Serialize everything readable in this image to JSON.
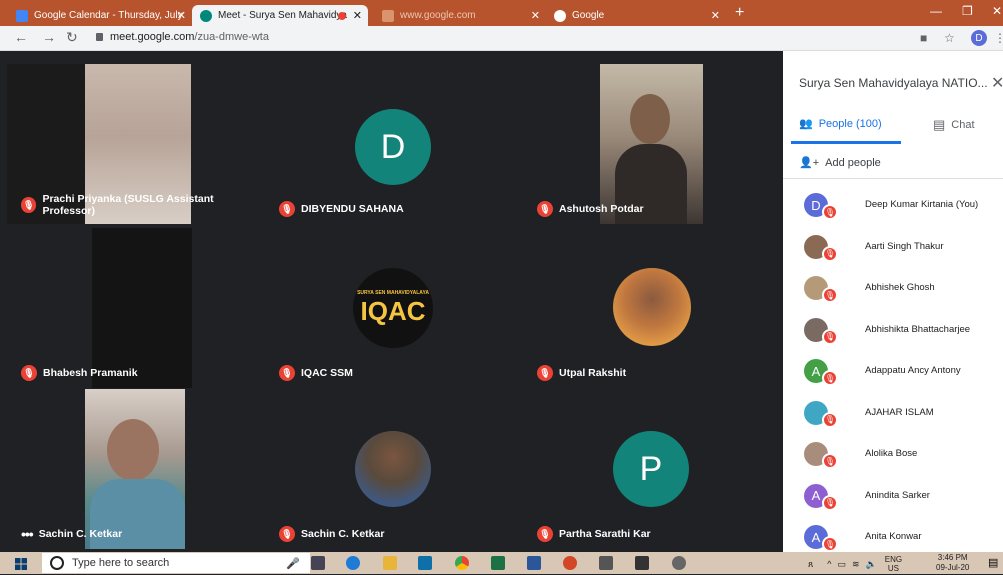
{
  "browser": {
    "tabs": [
      {
        "title": "Google Calendar - Thursday, July",
        "active": false,
        "favicon_color": "#4285f4"
      },
      {
        "title": "Meet - Surya Sen Mahavidya",
        "active": true,
        "favicon_color": "#00897b"
      },
      {
        "title": "www.google.com",
        "active": false,
        "favicon_color": "#d9936d"
      },
      {
        "title": "Google",
        "active": false,
        "favicon_color": "#ffffff"
      }
    ],
    "new_tab": "+",
    "url_host": "meet.google.com",
    "url_path": "/zua-dmwe-wta",
    "profile_initial": "D"
  },
  "participants_grid": [
    {
      "name": "Prachi Priyanka (SUSLG Assistant Professor)",
      "type": "video",
      "muted": true
    },
    {
      "name": "DIBYENDU SAHANA",
      "type": "avatar",
      "initial": "D",
      "color": "#12847a",
      "muted": true
    },
    {
      "name": "Ashutosh Potdar",
      "type": "video",
      "muted": true
    },
    {
      "name": "Bhabesh Pramanik",
      "type": "video",
      "muted": true
    },
    {
      "name": "IQAC SSM",
      "type": "logo",
      "logo_text": "IQAC",
      "logo_subtext": "SURYA SEN MAHAVIDYALAYA",
      "muted": true
    },
    {
      "name": "Utpal Rakshit",
      "type": "photo",
      "muted": true
    },
    {
      "name": "Sachin C. Ketkar",
      "type": "video",
      "muted": false,
      "more": "•••"
    },
    {
      "name": "Sachin C. Ketkar",
      "type": "photo",
      "muted": true
    },
    {
      "name": "Partha Sarathi Kar",
      "type": "avatar",
      "initial": "P",
      "color": "#12847a",
      "muted": true
    }
  ],
  "panel": {
    "title": "Surya Sen Mahavidyalaya NATIO...",
    "people_tab": "People (100)",
    "chat_tab": "Chat",
    "add_people": "Add people",
    "people": [
      {
        "name": "Deep Kumar Kirtania (You)",
        "initial": "D",
        "color": "#5b6bd8"
      },
      {
        "name": "Aarti Singh Thakur",
        "initial": "",
        "color": "#8a6a55"
      },
      {
        "name": "Abhishek Ghosh",
        "initial": "",
        "color": "#b59a7a"
      },
      {
        "name": "Abhishikta Bhattacharjee",
        "initial": "",
        "color": "#7a6b62"
      },
      {
        "name": "Adappatu Ancy Antony",
        "initial": "A",
        "color": "#43a047"
      },
      {
        "name": "AJAHAR ISLAM",
        "initial": "",
        "color": "#3fa7c4"
      },
      {
        "name": "Alolika Bose",
        "initial": "",
        "color": "#a88d7c"
      },
      {
        "name": "Anindita Sarker",
        "initial": "A",
        "color": "#8e5fd1"
      },
      {
        "name": "Anita Konwar",
        "initial": "A",
        "color": "#5b6bd8"
      }
    ]
  },
  "taskbar": {
    "search_placeholder": "Type here to search",
    "lang_top": "ENG",
    "lang_bottom": "US",
    "time": "3:46 PM",
    "date": "09-Jul-20"
  }
}
